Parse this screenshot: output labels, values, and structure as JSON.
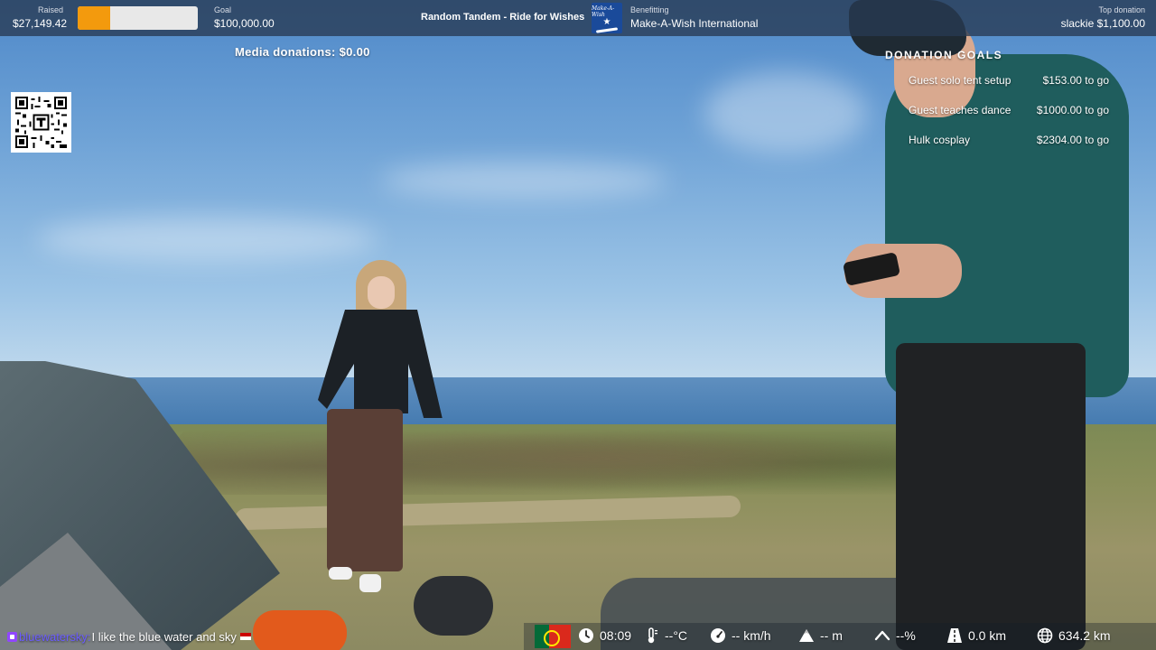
{
  "topbar": {
    "raised_label": "Raised",
    "raised_value": "$27,149.42",
    "progress_fraction": 0.2715,
    "goal_label": "Goal",
    "goal_value": "$100,000.00",
    "stream_title": "Random Tandem - Ride for Wishes",
    "logo_text": "Make-A-Wish",
    "benefit_label": "Benefitting",
    "benefit_value": "Make-A-Wish International",
    "top_donation_label": "Top donation",
    "top_donation_value": "slackie $1,100.00"
  },
  "media_donations": "Media donations: $0.00",
  "donation_goals": {
    "title": "DONATION GOALS",
    "items": [
      {
        "name": "Guest solo tent setup",
        "amount": "$153.00 to go"
      },
      {
        "name": "Guest teaches dance",
        "amount": "$1000.00 to go"
      },
      {
        "name": "Hulk cosplay",
        "amount": "$2304.00 to go"
      }
    ]
  },
  "chat": {
    "username": "bluewatersky:",
    "message": "I like the blue water and sky"
  },
  "stats": {
    "time": "08:09",
    "temperature": "--°C",
    "speed": "-- km/h",
    "altitude": "-- m",
    "grade": "--%",
    "distance_today": "0.0 km",
    "distance_total": "634.2 km"
  },
  "icons": {
    "flag": "portugal-flag-icon",
    "clock": "clock-icon",
    "thermometer": "thermometer-icon",
    "speedometer": "speedometer-icon",
    "mountain": "mountain-icon",
    "grade": "incline-icon",
    "road": "road-icon",
    "globe": "globe-icon"
  },
  "colors": {
    "progress_fill": "#f39a0d",
    "progress_track": "#e8e8e8",
    "topbar_bg": "#283a52",
    "chat_username": "#6b5cff",
    "twitch_badge": "#9146ff",
    "make_a_wish_blue": "#1a4a9a"
  }
}
